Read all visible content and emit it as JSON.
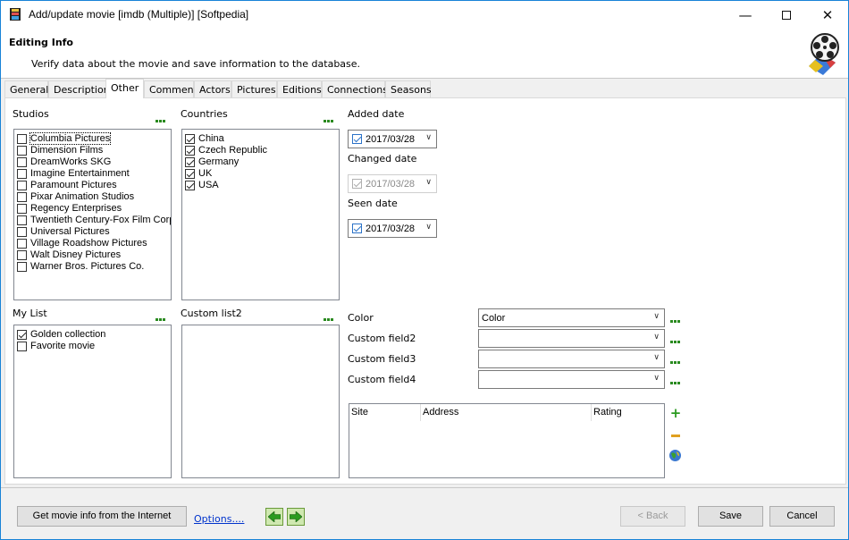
{
  "window": {
    "title": "Add/update movie [imdb (Multiple)] [Softpedia]"
  },
  "header": {
    "title": "Editing Info",
    "subtitle": "Verify data about the movie and save information to the database."
  },
  "tabs": [
    "General",
    "Description",
    "Other",
    "Comment",
    "Actors",
    "Pictures",
    "Editions",
    "Connections",
    "Seasons"
  ],
  "studios": {
    "label": "Studios",
    "items": [
      {
        "label": "Columbia Pictures",
        "checked": false
      },
      {
        "label": "Dimension Films",
        "checked": false
      },
      {
        "label": "DreamWorks SKG",
        "checked": false
      },
      {
        "label": "Imagine Entertainment",
        "checked": false
      },
      {
        "label": "Paramount Pictures",
        "checked": false
      },
      {
        "label": "Pixar Animation Studios",
        "checked": false
      },
      {
        "label": "Regency Enterprises",
        "checked": false
      },
      {
        "label": "Twentieth Century-Fox Film Corp",
        "checked": false
      },
      {
        "label": "Universal Pictures",
        "checked": false
      },
      {
        "label": "Village Roadshow Pictures",
        "checked": false
      },
      {
        "label": "Walt Disney Pictures",
        "checked": false
      },
      {
        "label": "Warner Bros. Pictures Co.",
        "checked": false
      }
    ]
  },
  "countries": {
    "label": "Countries",
    "items": [
      {
        "label": "China",
        "checked": true
      },
      {
        "label": "Czech Republic",
        "checked": true
      },
      {
        "label": "Germany",
        "checked": true
      },
      {
        "label": "UK",
        "checked": true
      },
      {
        "label": "USA",
        "checked": true
      }
    ]
  },
  "dates": {
    "added": {
      "label": "Added date",
      "value": "2017/03/28",
      "checked": true,
      "enabled": true
    },
    "changed": {
      "label": "Changed date",
      "value": "2017/03/28",
      "checked": true,
      "enabled": false
    },
    "seen": {
      "label": "Seen date",
      "value": "2017/03/28",
      "checked": true,
      "enabled": true
    }
  },
  "mylist": {
    "label": "My List",
    "items": [
      {
        "label": "Golden collection",
        "checked": true
      },
      {
        "label": "Favorite movie",
        "checked": false
      }
    ]
  },
  "customlist2": {
    "label": "Custom list2",
    "items": []
  },
  "fields": {
    "color": {
      "label": "Color",
      "value": "Color"
    },
    "custom2": {
      "label": "Custom field2",
      "value": ""
    },
    "custom3": {
      "label": "Custom field3",
      "value": ""
    },
    "custom4": {
      "label": "Custom field4",
      "value": ""
    }
  },
  "links_grid": {
    "columns": [
      "Site",
      "Address",
      "Rating"
    ]
  },
  "footer": {
    "get_info": "Get movie info from the Internet",
    "options": "Options....",
    "back": "< Back",
    "save": "Save",
    "cancel": "Cancel"
  },
  "colors": {
    "accent": "#1883d7",
    "dots": "#2a8a20",
    "link": "#0033cc"
  }
}
